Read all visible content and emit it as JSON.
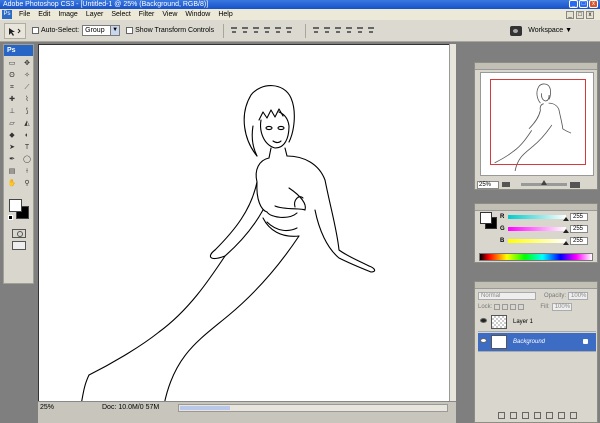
{
  "window": {
    "title": "Adobe Photoshop CS3 - [Untitled-1 @ 25% (Background, RGB/8)]",
    "buttons": [
      "_",
      "□",
      "x"
    ]
  },
  "menu": {
    "app_icon": "Ps",
    "items": [
      "File",
      "Edit",
      "Image",
      "Layer",
      "Select",
      "Filter",
      "View",
      "Window",
      "Help"
    ],
    "right_buttons": [
      "_",
      "□",
      "x"
    ]
  },
  "options": {
    "auto_select_label": "Auto-Select:",
    "auto_select_value": "Group",
    "transform_label": "Show Transform Controls",
    "workspace_label": "Workspace ▼"
  },
  "toolbox": {
    "logo": "Ps",
    "tools": [
      {
        "name": "marquee-icon",
        "glyph": "▭"
      },
      {
        "name": "move-icon",
        "glyph": "✥"
      },
      {
        "name": "lasso-icon",
        "glyph": "ʘ"
      },
      {
        "name": "magic-wand-icon",
        "glyph": "✧"
      },
      {
        "name": "crop-icon",
        "glyph": "⌗"
      },
      {
        "name": "slice-icon",
        "glyph": "⟋"
      },
      {
        "name": "healing-icon",
        "glyph": "✚"
      },
      {
        "name": "brush-icon",
        "glyph": "⌇"
      },
      {
        "name": "stamp-icon",
        "glyph": "⊥"
      },
      {
        "name": "history-brush-icon",
        "glyph": "⟆"
      },
      {
        "name": "eraser-icon",
        "glyph": "▱"
      },
      {
        "name": "bucket-icon",
        "glyph": "◭"
      },
      {
        "name": "blur-icon",
        "glyph": "◆"
      },
      {
        "name": "dodge-icon",
        "glyph": "◐"
      },
      {
        "name": "path-select-icon",
        "glyph": "➤"
      },
      {
        "name": "type-icon",
        "glyph": "T"
      },
      {
        "name": "pen-icon",
        "glyph": "✒"
      },
      {
        "name": "shape-icon",
        "glyph": "◯"
      },
      {
        "name": "notes-icon",
        "glyph": "▤"
      },
      {
        "name": "eyedropper-icon",
        "glyph": "⟊"
      },
      {
        "name": "hand-icon",
        "glyph": "✋"
      },
      {
        "name": "zoom-icon",
        "glyph": "⚲"
      }
    ]
  },
  "navigator": {
    "zoom": "25%"
  },
  "color": {
    "channels": [
      {
        "label": "R",
        "value": "255",
        "grad": "linear-gradient(to right, #00cccc, #ffffff)"
      },
      {
        "label": "G",
        "value": "255",
        "grad": "linear-gradient(to right, #ff00ff, #ffffff)"
      },
      {
        "label": "B",
        "value": "255",
        "grad": "linear-gradient(to right, #ffff00, #ffffff)"
      }
    ]
  },
  "layers": {
    "blend_mode": "Normal",
    "opacity_label": "Opacity:",
    "opacity_value": "100%",
    "lock_label": "Lock:",
    "fill_label": "Fill:",
    "fill_value": "100%",
    "items": [
      {
        "name": "Layer 1",
        "selected": false,
        "thumb": "checker"
      },
      {
        "name": "Background",
        "selected": true,
        "thumb": "white"
      }
    ]
  },
  "status": {
    "zoom": "25%",
    "doc_info": "Doc: 10.0M/0 57M"
  },
  "colors": {
    "accent": "#3d6cc4",
    "titlebar": "#1652c8",
    "nav_box": "#d63a3a"
  }
}
